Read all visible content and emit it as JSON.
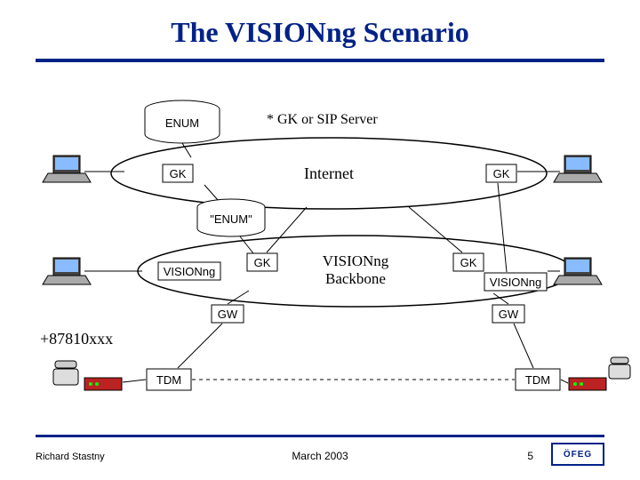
{
  "title": "The VISIONng Scenario",
  "note": "* GK or SIP Server",
  "clouds": {
    "internet": "Internet",
    "backbone_l1": "VISIONng",
    "backbone_l2": "Backbone"
  },
  "cylinders": {
    "enum": "ENUM",
    "enum_local": "\"ENUM\""
  },
  "boxes": {
    "gk": "GK",
    "gw": "GW",
    "tdm": "TDM",
    "visionng": "VISIONng"
  },
  "phone_number": "+87810xxx",
  "footer": {
    "author": "Richard Stastny",
    "date": "March 2003",
    "page": "5",
    "logo_text": "ÖFEG"
  }
}
